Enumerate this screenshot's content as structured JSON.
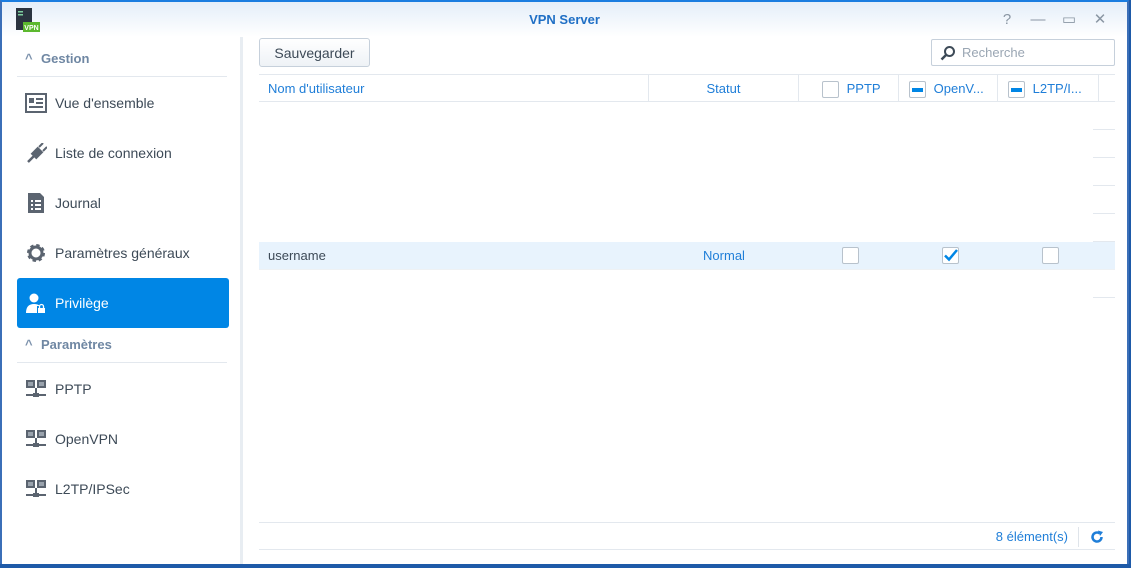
{
  "window": {
    "title": "VPN Server",
    "app_icon_label": "VPN"
  },
  "sidebar": {
    "sections": [
      {
        "label": "Gestion"
      },
      {
        "label": "Paramètres"
      }
    ],
    "items": [
      {
        "label": "Vue d'ensemble",
        "icon": "overview-icon"
      },
      {
        "label": "Liste de connexion",
        "icon": "plug-icon"
      },
      {
        "label": "Journal",
        "icon": "log-icon"
      },
      {
        "label": "Paramètres généraux",
        "icon": "gear-icon"
      },
      {
        "label": "Privilège",
        "icon": "user-lock-icon",
        "active": true
      },
      {
        "label": "PPTP",
        "icon": "network-icon"
      },
      {
        "label": "OpenVPN",
        "icon": "network-icon"
      },
      {
        "label": "L2TP/IPSec",
        "icon": "network-icon"
      }
    ]
  },
  "toolbar": {
    "save_label": "Sauvegarder",
    "search_placeholder": "Recherche"
  },
  "table": {
    "columns": [
      "Nom d'utilisateur",
      "Statut",
      "PPTP",
      "OpenV...",
      "L2TP/I..."
    ],
    "rows": [
      {
        "user": "username",
        "status": "Normal",
        "pptp": false,
        "openvpn": true,
        "l2tp": false
      }
    ]
  },
  "footer": {
    "count": "8 élément(s)"
  },
  "colors": {
    "accent": "#0086e5",
    "title": "#1f6fc5"
  }
}
